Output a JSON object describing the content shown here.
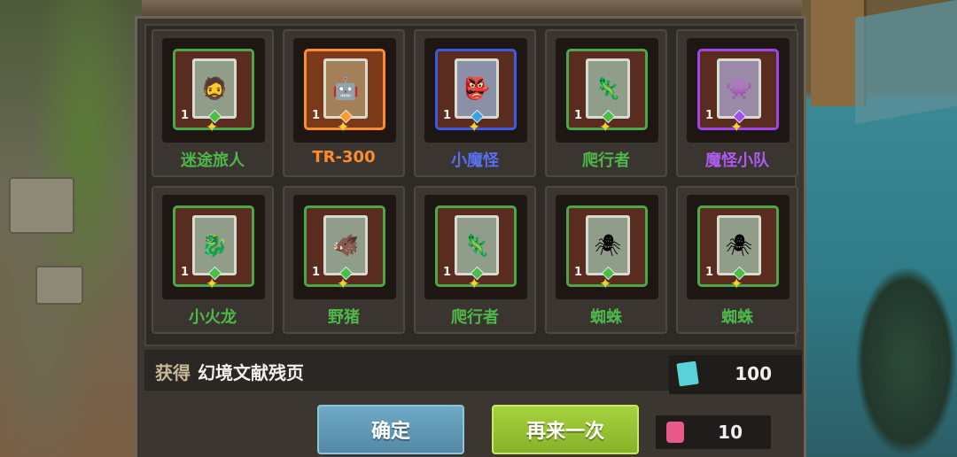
{
  "header": {
    "title": ""
  },
  "cards": [
    {
      "name": "迷途旅人",
      "count": "1",
      "rarity": "green",
      "icon": "traveler-figure"
    },
    {
      "name": "TR-300",
      "count": "1",
      "rarity": "orange",
      "icon": "robot-figure"
    },
    {
      "name": "小魔怪",
      "count": "1",
      "rarity": "blue",
      "icon": "imp-figure"
    },
    {
      "name": "爬行者",
      "count": "1",
      "rarity": "green",
      "icon": "crawler-figure"
    },
    {
      "name": "魔怪小队",
      "count": "1",
      "rarity": "purple",
      "icon": "monster-squad-figure"
    },
    {
      "name": "小火龙",
      "count": "1",
      "rarity": "green",
      "icon": "fire-dragon-figure"
    },
    {
      "name": "野猪",
      "count": "1",
      "rarity": "green",
      "icon": "boar-figure"
    },
    {
      "name": "爬行者",
      "count": "1",
      "rarity": "green",
      "icon": "crawler-figure"
    },
    {
      "name": "蜘蛛",
      "count": "1",
      "rarity": "green",
      "icon": "spider-figure"
    },
    {
      "name": "蜘蛛",
      "count": "1",
      "rarity": "green",
      "icon": "spider-figure"
    }
  ],
  "reward": {
    "label": "获得",
    "item": "幻境文献残页",
    "currency_icon": "page-fragment-icon",
    "amount": "100"
  },
  "buttons": {
    "confirm": "确定",
    "again": "再来一次"
  },
  "cost": {
    "icon": "ticket-pouch-icon",
    "amount": "10"
  },
  "colors": {
    "green": "#4fb84a",
    "orange": "#ff8c2a",
    "blue": "#5a6ef0",
    "purple": "#b05af0",
    "confirm_button": "#5f98b5",
    "again_button": "#96c232"
  }
}
